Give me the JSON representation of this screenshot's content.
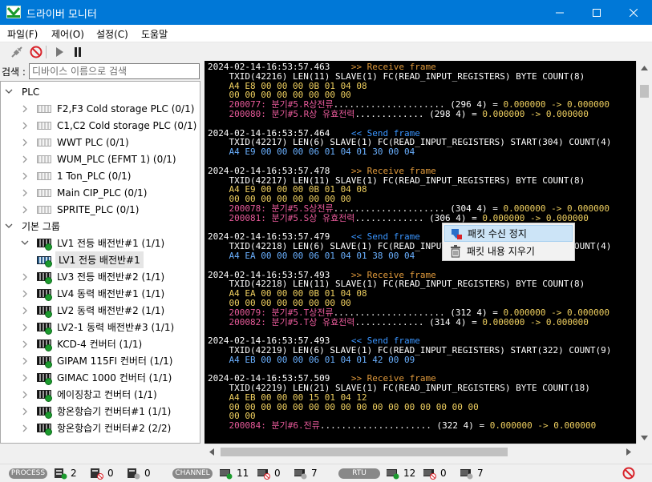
{
  "window": {
    "title": "드라이버 모니터",
    "accent": "#0078d7"
  },
  "menu": [
    "파일(F)",
    "제어(O)",
    "설정(C)",
    "도움말"
  ],
  "search": {
    "label": "검색 :",
    "placeholder": "디바이스 이름으로 검색"
  },
  "tree": [
    {
      "label": "PLC",
      "level": 0,
      "icon": "folder",
      "expanded": true
    },
    {
      "label": "F2,F3 Cold storage PLC (0/1)",
      "level": 1,
      "icon": "plc-icon",
      "expanded": false
    },
    {
      "label": "C1,C2 Cold storage PLC (0/1)",
      "level": 1,
      "icon": "plc-icon",
      "expanded": false
    },
    {
      "label": "WWT PLC (0/1)",
      "level": 1,
      "icon": "plc-icon",
      "expanded": false
    },
    {
      "label": "WUM_PLC (EFMT 1) (0/1)",
      "level": 1,
      "icon": "plc-icon",
      "expanded": false
    },
    {
      "label": "1 Ton_PLC (0/1)",
      "level": 1,
      "icon": "plc-icon",
      "expanded": false
    },
    {
      "label": "Main CIP_PLC (0/1)",
      "level": 1,
      "icon": "plc-icon",
      "expanded": false
    },
    {
      "label": "SPRITE_PLC (0/1)",
      "level": 1,
      "icon": "plc-icon",
      "expanded": false
    },
    {
      "label": "기본 그룹",
      "level": 0,
      "icon": "folder",
      "expanded": true
    },
    {
      "label": "LV1 전등 배전반#1 (1/1)",
      "level": 1,
      "icon": "group-online-icon",
      "expanded": true
    },
    {
      "label": "LV1 전등 배전반#1",
      "level": 2,
      "icon": "device-icon",
      "selected": true
    },
    {
      "label": "LV3 전등 배전반#2 (1/1)",
      "level": 1,
      "icon": "group-online-icon",
      "expanded": false
    },
    {
      "label": "LV4 동력 배전반#1 (1/1)",
      "level": 1,
      "icon": "group-online-icon",
      "expanded": false
    },
    {
      "label": "LV2 동력 배전반#2 (1/1)",
      "level": 1,
      "icon": "group-online-icon",
      "expanded": false
    },
    {
      "label": "LV2-1 동력 배전반#3 (1/1)",
      "level": 1,
      "icon": "group-online-icon",
      "expanded": false
    },
    {
      "label": "KCD-4 컨버터 (1/1)",
      "level": 1,
      "icon": "group-online-icon",
      "expanded": false
    },
    {
      "label": "GIPAM 115FI 컨버터 (1/1)",
      "level": 1,
      "icon": "group-online-icon",
      "expanded": false
    },
    {
      "label": "GIMAC 1000 컨버터 (1/1)",
      "level": 1,
      "icon": "group-online-icon",
      "expanded": false
    },
    {
      "label": "에이징창고 컨버터 (1/1)",
      "level": 1,
      "icon": "group-online-icon",
      "expanded": false
    },
    {
      "label": "항온항습기 컨버터#1 (1/1)",
      "level": 1,
      "icon": "group-online-icon",
      "expanded": false
    },
    {
      "label": "항온항습기 컨버터#2 (2/2)",
      "level": 1,
      "icon": "group-online-icon",
      "expanded": false
    }
  ],
  "log": [
    [
      [
        "ts",
        "2024-02-14-16:53:57.463"
      ],
      [
        "rcv",
        "    >> Receive frame"
      ]
    ],
    [
      [
        "plain",
        "    TXID(42216) LEN(11) SLAVE(1) FC(READ_INPUT_REGISTERS) BYTE COUNT(8)"
      ]
    ],
    [
      [
        "hex",
        "    A4 E8 00 00 00 0B 01 04 08"
      ]
    ],
    [
      [
        "hex",
        "    00 00 00 00 00 00 00 00"
      ]
    ],
    [
      [
        "reg",
        "    200077: 분기#5.R상전류"
      ],
      [
        "plain",
        "..................... (296 4) = "
      ],
      [
        "val",
        "0.000000 -> 0.000000"
      ]
    ],
    [
      [
        "reg",
        "    200080: 분기#5.R상 유효전력"
      ],
      [
        "plain",
        "............. (298 4) = "
      ],
      [
        "val",
        "0.000000 -> 0.000000"
      ]
    ],
    [
      [
        "plain",
        ""
      ]
    ],
    [
      [
        "ts",
        "2024-02-14-16:53:57.464"
      ],
      [
        "snd",
        "    << Send frame"
      ]
    ],
    [
      [
        "plain",
        "    TXID(42217) LEN(6) SLAVE(1) FC(READ_INPUT_REGISTERS) START(304) COUNT(4)"
      ]
    ],
    [
      [
        "hexs",
        "    A4 E9 00 00 00 06 01 04 01 30 00 04"
      ]
    ],
    [
      [
        "plain",
        ""
      ]
    ],
    [
      [
        "ts",
        "2024-02-14-16:53:57.478"
      ],
      [
        "rcv",
        "    >> Receive frame"
      ]
    ],
    [
      [
        "plain",
        "    TXID(42217) LEN(11) SLAVE(1) FC(READ_INPUT_REGISTERS) BYTE COUNT(8)"
      ]
    ],
    [
      [
        "hex",
        "    A4 E9 00 00 00 0B 01 04 08"
      ]
    ],
    [
      [
        "hex",
        "    00 00 00 00 00 00 00 00"
      ]
    ],
    [
      [
        "reg",
        "    200078: 분기#5.S상전류"
      ],
      [
        "plain",
        "..................... (304 4) = "
      ],
      [
        "val",
        "0.000000 -> 0.000000"
      ]
    ],
    [
      [
        "reg",
        "    200081: 분기#5.S상 유효전력"
      ],
      [
        "plain",
        "............. (306 4) = "
      ],
      [
        "val",
        "0.000000 -> 0.000000"
      ]
    ],
    [
      [
        "plain",
        ""
      ]
    ],
    [
      [
        "ts",
        "2024-02-14-16:53:57.479"
      ],
      [
        "snd",
        "    << Send frame"
      ]
    ],
    [
      [
        "plain",
        "    TXID(42218) LEN(6) SLAVE(1) FC(READ_INPUT_REGISTERS) START(312) COUNT(4)"
      ]
    ],
    [
      [
        "hexs",
        "    A4 EA 00 00 00 06 01 04 01 38 00 04"
      ]
    ],
    [
      [
        "plain",
        ""
      ]
    ],
    [
      [
        "ts",
        "2024-02-14-16:53:57.493"
      ],
      [
        "rcv",
        "    >> Receive frame"
      ]
    ],
    [
      [
        "plain",
        "    TXID(42218) LEN(11) SLAVE(1) FC(READ_INPUT_REGISTERS) BYTE COUNT(8)"
      ]
    ],
    [
      [
        "hex",
        "    A4 EA 00 00 00 0B 01 04 08"
      ]
    ],
    [
      [
        "hex",
        "    00 00 00 00 00 00 00 00"
      ]
    ],
    [
      [
        "reg",
        "    200079: 분기#5.T상전류"
      ],
      [
        "plain",
        "..................... (312 4) = "
      ],
      [
        "val",
        "0.000000 -> 0.000000"
      ]
    ],
    [
      [
        "reg",
        "    200082: 분기#5.T상 유효전력"
      ],
      [
        "plain",
        "............. (314 4) = "
      ],
      [
        "val",
        "0.000000 -> 0.000000"
      ]
    ],
    [
      [
        "plain",
        ""
      ]
    ],
    [
      [
        "ts",
        "2024-02-14-16:53:57.493"
      ],
      [
        "snd",
        "    << Send frame"
      ]
    ],
    [
      [
        "plain",
        "    TXID(42219) LEN(6) SLAVE(1) FC(READ_INPUT_REGISTERS) START(322) COUNT(9)"
      ]
    ],
    [
      [
        "hexs",
        "    A4 EB 00 00 00 06 01 04 01 42 00 09"
      ]
    ],
    [
      [
        "plain",
        ""
      ]
    ],
    [
      [
        "ts",
        "2024-02-14-16:53:57.509"
      ],
      [
        "rcv",
        "    >> Receive frame"
      ]
    ],
    [
      [
        "plain",
        "    TXID(42219) LEN(21) SLAVE(1) FC(READ_INPUT_REGISTERS) BYTE COUNT(18)"
      ]
    ],
    [
      [
        "hex",
        "    A4 EB 00 00 00 15 01 04 12"
      ]
    ],
    [
      [
        "hex",
        "    00 00 00 00 00 00 00 00 00 00 00 00 00 00 00 00"
      ]
    ],
    [
      [
        "hex",
        "    00 00"
      ]
    ],
    [
      [
        "reg",
        "    200084: 분기#6.전류"
      ],
      [
        "plain",
        "..................... (322 4) = "
      ],
      [
        "val",
        "0.000000 -> 0.000000"
      ]
    ]
  ],
  "context_menu": {
    "stop_label": "패킷 수신 정지",
    "clear_label": "패킷 내용 지우기"
  },
  "status": {
    "process_label": "PROCESS",
    "process_ok": "2",
    "process_err": "0",
    "process_off": "0",
    "channel_label": "CHANNEL",
    "channel_ok": "11",
    "channel_err": "0",
    "channel_off": "7",
    "rtu_label": "RTU",
    "rtu_ok": "12",
    "rtu_err": "0",
    "rtu_off": "7"
  }
}
